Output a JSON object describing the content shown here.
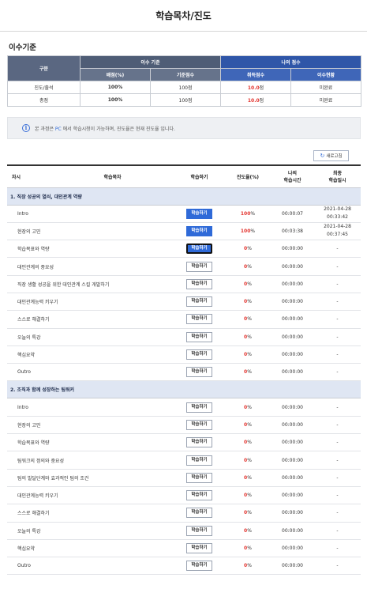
{
  "page_title": "학습목차/진도",
  "criteria": {
    "section_title": "이수기준",
    "header": {
      "gubun": "구분",
      "standard_group": "이수 기준",
      "my_score_group": "나의 점수",
      "col_ratio": "배점(%)",
      "col_base_score": "기준점수",
      "col_acquired": "취득점수",
      "col_status": "이수현황"
    },
    "rows": [
      {
        "label": "진도/출석",
        "ratio": "100%",
        "base": "100점",
        "acquired": "10.0",
        "acquired_unit": "점",
        "status": "미완료"
      },
      {
        "label": "총점",
        "ratio": "100%",
        "base": "100점",
        "acquired": "10.0",
        "acquired_unit": "점",
        "status": "미완료"
      }
    ]
  },
  "notice": {
    "icon": "info-icon",
    "text_before": "본 과정은",
    "text_pc": "PC",
    "text_after": "에서 학습시청이 가능하며, 진도율은 현재 진도율 입니다."
  },
  "refresh_label": "새로고침",
  "toc": {
    "headers": {
      "chasi": "차시",
      "title": "학습목차",
      "study": "학습하기",
      "progress": "진도율(%)",
      "my_time_1": "나의",
      "my_time_2": "학습시간",
      "last_1": "최종",
      "last_2": "학습일시"
    },
    "study_label": "학습하기",
    "chapters": [
      {
        "title": "1. 직장 성공의 열쇠, 대인관계 역량",
        "lessons": [
          {
            "name": "Intro",
            "progress": "100",
            "time": "00:00:07",
            "date": "2021-04-28",
            "clock": "00:33:42",
            "btn": "active"
          },
          {
            "name": "현장의 고민",
            "progress": "100",
            "time": "00:03:38",
            "date": "2021-04-28",
            "clock": "00:37:45",
            "btn": "active"
          },
          {
            "name": "학습목표와 역량",
            "progress": "0",
            "time": "00:00:00",
            "date": "-",
            "clock": "",
            "btn": "focus"
          },
          {
            "name": "대인관계의 중요성",
            "progress": "0",
            "time": "00:00:00",
            "date": "-",
            "clock": "",
            "btn": "normal"
          },
          {
            "name": "직장 생활 성공을 위한 대인관계 스킬 개발하기",
            "progress": "0",
            "time": "00:00:00",
            "date": "-",
            "clock": "",
            "btn": "normal"
          },
          {
            "name": "대인관계능력 키우기",
            "progress": "0",
            "time": "00:00:00",
            "date": "-",
            "clock": "",
            "btn": "normal"
          },
          {
            "name": "스스로 해결하기",
            "progress": "0",
            "time": "00:00:00",
            "date": "-",
            "clock": "",
            "btn": "normal"
          },
          {
            "name": "오늘의 특강",
            "progress": "0",
            "time": "00:00:00",
            "date": "-",
            "clock": "",
            "btn": "normal"
          },
          {
            "name": "핵심요약",
            "progress": "0",
            "time": "00:00:00",
            "date": "-",
            "clock": "",
            "btn": "normal"
          },
          {
            "name": "Outro",
            "progress": "0",
            "time": "00:00:00",
            "date": "-",
            "clock": "",
            "btn": "normal"
          }
        ]
      },
      {
        "title": "2. 조직과 함께 성장하는 팀워커",
        "lessons": [
          {
            "name": "Intro",
            "progress": "0",
            "time": "00:00:00",
            "date": "-",
            "clock": "",
            "btn": "normal"
          },
          {
            "name": "현장의 고민",
            "progress": "0",
            "time": "00:00:00",
            "date": "-",
            "clock": "",
            "btn": "normal"
          },
          {
            "name": "학습목표와 역량",
            "progress": "0",
            "time": "00:00:00",
            "date": "-",
            "clock": "",
            "btn": "normal"
          },
          {
            "name": "팀워크의 정의와 중요성",
            "progress": "0",
            "time": "00:00:00",
            "date": "-",
            "clock": "",
            "btn": "normal"
          },
          {
            "name": "팀의 발달단계와 효과적인 팀의 조건",
            "progress": "0",
            "time": "00:00:00",
            "date": "-",
            "clock": "",
            "btn": "normal"
          },
          {
            "name": "대인관계능력 키우기",
            "progress": "0",
            "time": "00:00:00",
            "date": "-",
            "clock": "",
            "btn": "normal"
          },
          {
            "name": "스스로 해결하기",
            "progress": "0",
            "time": "00:00:00",
            "date": "-",
            "clock": "",
            "btn": "normal"
          },
          {
            "name": "오늘의 특강",
            "progress": "0",
            "time": "00:00:00",
            "date": "-",
            "clock": "",
            "btn": "normal"
          },
          {
            "name": "핵심요약",
            "progress": "0",
            "time": "00:00:00",
            "date": "-",
            "clock": "",
            "btn": "normal"
          },
          {
            "name": "Outro",
            "progress": "0",
            "time": "00:00:00",
            "date": "-",
            "clock": "",
            "btn": "normal"
          }
        ]
      }
    ]
  },
  "colors": {
    "accent_blue": "#2f6ad8",
    "header_navy": "#4f5d76",
    "score_red": "#e3342f",
    "chapter_bg": "#dfe6f3"
  }
}
